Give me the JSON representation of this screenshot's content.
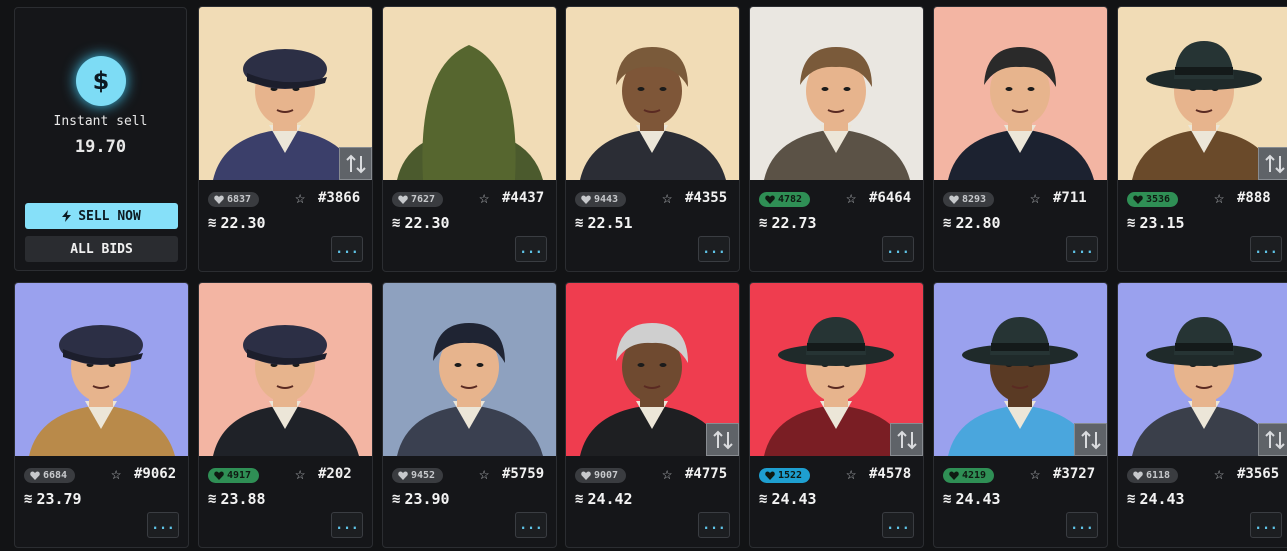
{
  "instant_sell": {
    "icon": "dollar-icon",
    "label": "Instant sell",
    "value": "19.70",
    "sell_now_label": "SELL NOW",
    "all_bids_label": "ALL BIDS",
    "accent": "#86e0f9"
  },
  "colors": {
    "badge_dark": "#3a3c40",
    "badge_green": "#2f8f55",
    "badge_cyan": "#1e9fd0"
  },
  "cards": [
    {
      "likes": "6837",
      "badge": "dark",
      "id": "#3866",
      "price": "22.30",
      "bg": "#f1dcb6",
      "hat": "cap",
      "hair": "#5a3a22",
      "outfit": "#3b3f6a",
      "skin": "#e7b48d",
      "swap": true
    },
    {
      "likes": "7627",
      "badge": "dark",
      "id": "#4437",
      "price": "22.30",
      "bg": "#f1dcb6",
      "hat": "hood",
      "hair": "#2b2b1a",
      "outfit": "#4b5a2d",
      "skin": "#6f4a30",
      "swap": false
    },
    {
      "likes": "9443",
      "badge": "dark",
      "id": "#4355",
      "price": "22.51",
      "bg": "#f1dcb6",
      "hat": "none",
      "hair": "#7a5a3a",
      "outfit": "#2b2d35",
      "skin": "#7e5638",
      "swap": false
    },
    {
      "likes": "4782",
      "badge": "green",
      "id": "#6464",
      "price": "22.73",
      "bg": "#eae7e1",
      "hat": "none",
      "hair": "#7a5a3a",
      "outfit": "#5b5246",
      "skin": "#e7b48d",
      "swap": false
    },
    {
      "likes": "8293",
      "badge": "dark",
      "id": "#711",
      "price": "22.80",
      "bg": "#f3b5a3",
      "hat": "none",
      "hair": "#2a2a2a",
      "outfit": "#1c2230",
      "skin": "#e7b48d",
      "swap": false
    },
    {
      "likes": "3536",
      "badge": "green",
      "id": "#888",
      "price": "23.15",
      "bg": "#f1dcb6",
      "hat": "fedora",
      "hair": "#2a2a2a",
      "outfit": "#6a4a2a",
      "skin": "#e7b48d",
      "swap": true
    },
    {
      "likes": "6684",
      "badge": "dark",
      "id": "#9062",
      "price": "23.79",
      "bg": "#9aa1ee",
      "hat": "cap",
      "hair": "#3a2a1a",
      "outfit": "#b98a4a",
      "skin": "#e7b48d",
      "swap": false
    },
    {
      "likes": "4917",
      "badge": "green",
      "id": "#202",
      "price": "23.88",
      "bg": "#f3b5a3",
      "hat": "cap",
      "hair": "#2a2a2a",
      "outfit": "#1f2228",
      "skin": "#e7b48d",
      "swap": false
    },
    {
      "likes": "9452",
      "badge": "dark",
      "id": "#5759",
      "price": "23.90",
      "bg": "#8ea1bf",
      "hat": "none",
      "hair": "#1f2433",
      "outfit": "#3a4050",
      "skin": "#e7b48d",
      "swap": false
    },
    {
      "likes": "9007",
      "badge": "dark",
      "id": "#4775",
      "price": "24.42",
      "bg": "#ef3d4f",
      "hat": "none",
      "hair": "#cfcfcf",
      "outfit": "#1e1f22",
      "skin": "#6f4a30",
      "swap": true
    },
    {
      "likes": "1522",
      "badge": "cyan",
      "id": "#4578",
      "price": "24.43",
      "bg": "#ef3d4f",
      "hat": "fedora",
      "hair": "#2a2a2a",
      "outfit": "#7a1e24",
      "skin": "#e7b48d",
      "swap": true
    },
    {
      "likes": "4219",
      "badge": "green",
      "id": "#3727",
      "price": "24.43",
      "bg": "#9aa1ee",
      "hat": "fedora",
      "hair": "#2a2a2a",
      "outfit": "#4aa6dd",
      "skin": "#5a3a24",
      "swap": true
    },
    {
      "likes": "6118",
      "badge": "dark",
      "id": "#3565",
      "price": "24.43",
      "bg": "#9aa1ee",
      "hat": "fedora",
      "hair": "#2a2a2a",
      "outfit": "#3a3f4a",
      "skin": "#e7b48d",
      "swap": true
    }
  ],
  "card_more_label": "...",
  "icons": {
    "heart": "heart-icon",
    "star": "star-icon",
    "coin": "coin-icon",
    "swap": "swap-icon",
    "more": "more-icon"
  }
}
